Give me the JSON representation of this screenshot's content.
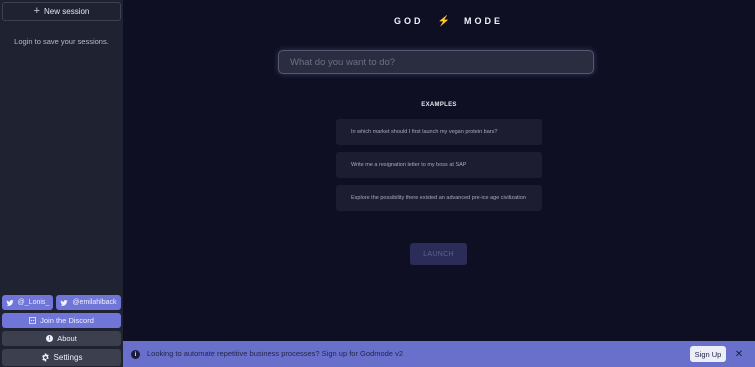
{
  "sidebar": {
    "new_session_label": "New session",
    "login_note": "Login to save your sessions.",
    "twitter_1": "@_Lonis_",
    "twitter_2": "@emilahlback",
    "discord": "Join the Discord",
    "about": "About",
    "settings": "Settings"
  },
  "header": {
    "logo_left": "GOD",
    "logo_right": "MODE",
    "logo_icon": "lightning-bolt-icon"
  },
  "prompt": {
    "placeholder": "What do you want to do?",
    "value": ""
  },
  "examples": {
    "title": "EXAMPLES",
    "items": [
      "In which market should I first launch my vegan protein bars?",
      "Write me a resignation letter to my boss at SAP",
      "Explore the possibility there existed an advanced pre-ice age civilization"
    ]
  },
  "launch_label": "LAUNCH",
  "banner": {
    "text": "Looking to automate repetitive business processes? Sign up for Godmode v2",
    "signup_label": "Sign Up",
    "close_label": "✕"
  },
  "colors": {
    "background": "#0f0f24",
    "sidebar": "#1f2230",
    "accent": "#6f76d8",
    "banner": "#6970cc",
    "bolt": "#f5c518"
  }
}
